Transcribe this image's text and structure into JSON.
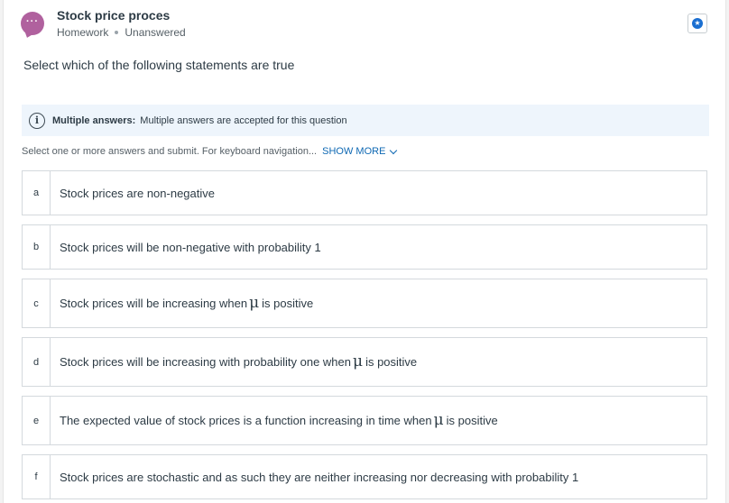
{
  "header": {
    "avatar_glyph": "···",
    "title": "Stock price proces",
    "type": "Homework",
    "status": "Unanswered"
  },
  "prompt": "Select which of the following statements are true",
  "info": {
    "label": "Multiple answers:",
    "text": "Multiple answers are accepted for this question"
  },
  "instructions": {
    "text": "Select one or more answers and submit. For keyboard navigation...",
    "show_more": "SHOW MORE"
  },
  "options": [
    {
      "letter": "a",
      "before": "Stock prices are non-negative",
      "symbol": "",
      "after": ""
    },
    {
      "letter": "b",
      "before": "Stock prices will be non-negative with probability 1",
      "symbol": "",
      "after": ""
    },
    {
      "letter": "c",
      "before": "Stock prices will be increasing when",
      "symbol": "μ",
      "after": "is positive"
    },
    {
      "letter": "d",
      "before": "Stock prices will be increasing with probability one when",
      "symbol": "μ",
      "after": "is positive"
    },
    {
      "letter": "e",
      "before": "The expected value of stock prices is a function increasing in time when",
      "symbol": "μ",
      "after": "is positive"
    },
    {
      "letter": "f",
      "before": "Stock prices are stochastic and as such they are neither increasing nor decreasing with probability 1",
      "symbol": "",
      "after": ""
    }
  ],
  "colors": {
    "avatar": "#b0619e",
    "accent": "#0e68b3",
    "info_bg": "#eef5fc"
  }
}
